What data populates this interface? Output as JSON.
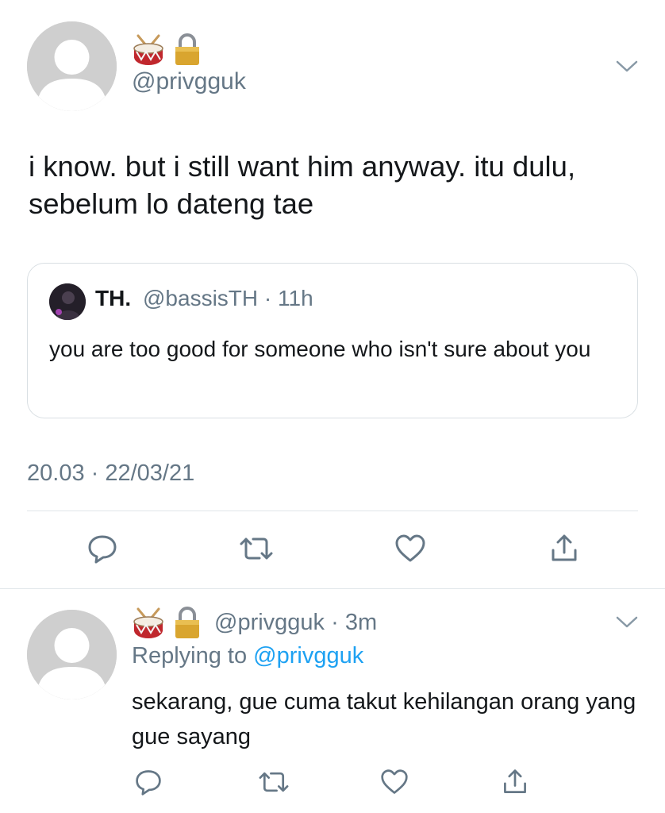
{
  "tweet": {
    "handle": "@privgguk",
    "text": "i know. but i still want him anyway. itu dulu, sebelum lo dateng tae",
    "timestamp": "20.03 · 22/03/21",
    "name_icons": [
      "drum-icon",
      "lock-icon"
    ],
    "actions": [
      "reply-icon",
      "retweet-icon",
      "like-icon",
      "share-icon"
    ]
  },
  "quoted": {
    "name": "TH.",
    "handle": "@bassisTH",
    "time": "· 11h",
    "text": "you are too good for someone who isn't sure about you"
  },
  "reply": {
    "handle": "@privgguk",
    "time": "· 3m",
    "replying_prefix": "Replying to",
    "replying_to": "@privgguk",
    "text": "sekarang, gue cuma takut kehilangan orang yang gue sayang"
  },
  "colors": {
    "text": "#14171a",
    "secondary": "#657786",
    "link": "#1da1f2",
    "divider": "#e1e6ea"
  }
}
